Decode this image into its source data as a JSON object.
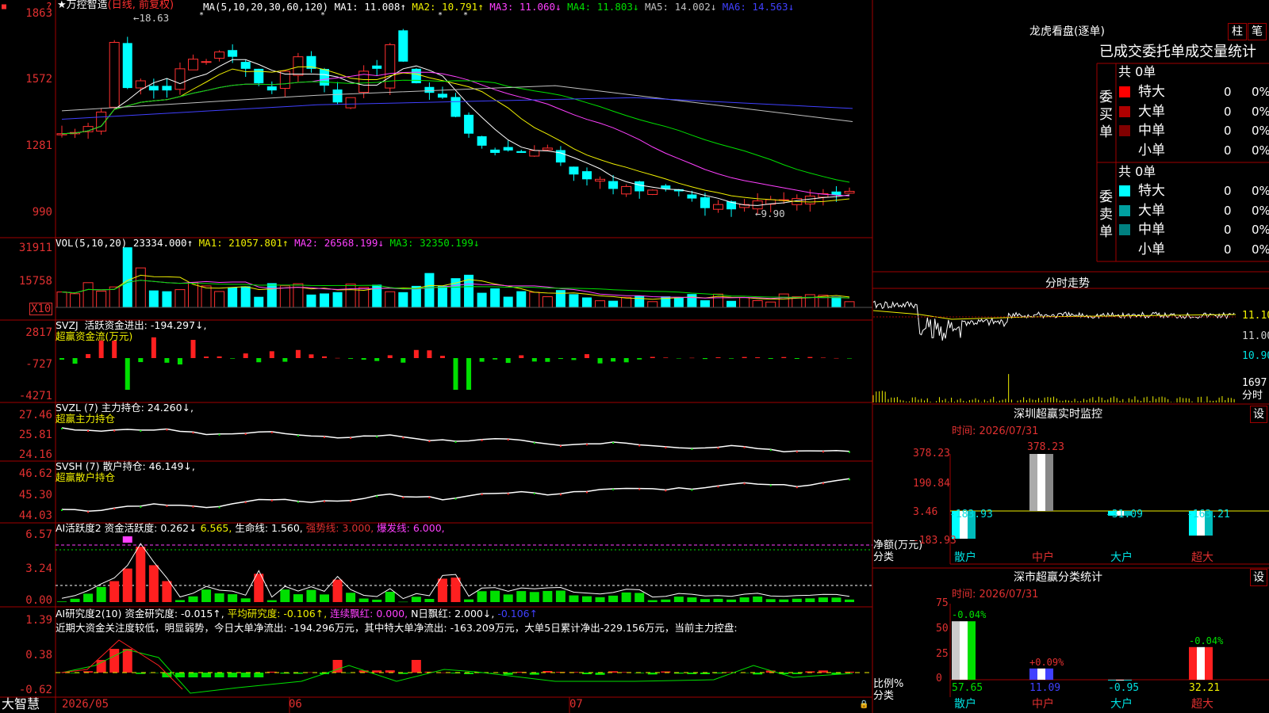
{
  "app": {
    "brand": "大智慧"
  },
  "stock": {
    "name": "万控智造",
    "period_label": "(日线, 前复权)",
    "star": "★",
    "high_mark": "←18.63",
    "low_mark": "←9.90"
  },
  "price_panel": {
    "ticks": [
      "1863",
      "1572",
      "1281",
      "990"
    ],
    "ma_items": [
      {
        "label": "MA(5,10,20,30,60,120)",
        "color": "#ffffff"
      },
      {
        "label": "MA1: 11.008↑",
        "color": "#ffffff"
      },
      {
        "label": "MA2: 10.791↑",
        "color": "#f0f000"
      },
      {
        "label": "MA3: 11.060↓",
        "color": "#ff40ff"
      },
      {
        "label": "MA4: 11.803↓",
        "color": "#00e000"
      },
      {
        "label": "MA5: 14.002↓",
        "color": "#c0c0c0"
      },
      {
        "label": "MA6: 14.563↓",
        "color": "#4040ff"
      }
    ]
  },
  "vol_panel": {
    "ticks": [
      "31911",
      "15758"
    ],
    "x10": "X10",
    "items": [
      {
        "label": "VOL(5,10,20)",
        "color": "#ffffff"
      },
      {
        "label": "23334.000↑",
        "color": "#ffffff"
      },
      {
        "label": "MA1: 21057.801↑",
        "color": "#f0f000"
      },
      {
        "label": "MA2: 26568.199↓",
        "color": "#ff40ff"
      },
      {
        "label": "MA3: 32350.199↓",
        "color": "#00e000"
      }
    ]
  },
  "svzj_panel": {
    "ticks": [
      "2817",
      "-727",
      "-4271"
    ],
    "title": "SVZJ  活跃资金进出: -194.297↓,",
    "subtitle": "超赢资金流(万元)"
  },
  "svzl_panel": {
    "ticks": [
      "27.46",
      "25.81",
      "24.16"
    ],
    "title": "SVZL (7) 主力持仓: 24.260↓,",
    "subtitle": "超赢主力持仓"
  },
  "svsh_panel": {
    "ticks": [
      "46.62",
      "45.30",
      "44.03"
    ],
    "title": "SVSH (7) 散户持仓: 46.149↓,",
    "subtitle": "超赢散户持仓"
  },
  "ai_panel": {
    "ticks": [
      "6.57",
      "3.24",
      "0.00"
    ],
    "items": [
      {
        "label": "AI活跃度2 资金活跃度: 0.262↓",
        "color": "#ffffff"
      },
      {
        "label": "6.565,",
        "color": "#f0f000"
      },
      {
        "label": "生命线: 1.560,",
        "color": "#ffffff"
      },
      {
        "label": "强势线: 3.000,",
        "color": "#e03030"
      },
      {
        "label": "爆发线: 6.000,",
        "color": "#ff40ff"
      }
    ]
  },
  "research_panel": {
    "ticks": [
      "1.39",
      "0.38",
      "-0.62"
    ],
    "items": [
      {
        "label": "AI研究度2(10) 资金研究度: -0.015↑,",
        "color": "#ffffff"
      },
      {
        "label": "平均研究度: -0.106↑,",
        "color": "#f0f000"
      },
      {
        "label": "连续飘红: 0.000,",
        "color": "#ff40ff"
      },
      {
        "label": "N日飘红: 2.000↓,",
        "color": "#ffffff"
      },
      {
        "label": "-0.106↑",
        "color": "#4040ff"
      }
    ],
    "note": "近期大资金关注度较低，明显弱势，今日大单净流出: -194.296万元，其中特大单净流出: -163.209万元，大单5日累计净出-229.156万元，当前主力控盘:"
  },
  "time_axis": {
    "labels": [
      "2026/05",
      "06",
      "07"
    ]
  },
  "longhu": {
    "title": "龙虎看盘(逐单)",
    "btn_col": "柱",
    "btn_pen": "笔",
    "header": "已成交委托单成交量统计",
    "buy_label": "委买单",
    "sell_label": "委卖单",
    "buy_total": "共 0单",
    "sell_total": "共 0单",
    "buy_rows": [
      {
        "name": "特大",
        "color": "#ff0000",
        "qty": "0",
        "pct": "0%"
      },
      {
        "name": "大单",
        "color": "#b00000",
        "qty": "0",
        "pct": "0%"
      },
      {
        "name": "中单",
        "color": "#800000",
        "qty": "0",
        "pct": "0%"
      },
      {
        "name": "小单",
        "color": "#000000",
        "qty": "0",
        "pct": "0%"
      }
    ],
    "sell_rows": [
      {
        "name": "特大",
        "color": "#00ffff",
        "qty": "0",
        "pct": "0%"
      },
      {
        "name": "大单",
        "color": "#00a0a0",
        "qty": "0",
        "pct": "0%"
      },
      {
        "name": "中单",
        "color": "#008080",
        "qty": "0",
        "pct": "0%"
      },
      {
        "name": "小单",
        "color": "#000000",
        "qty": "0",
        "pct": "0%"
      }
    ]
  },
  "intraday": {
    "title": "分时走势",
    "ticks": [
      "11.10",
      "11.00",
      "10.90"
    ],
    "vol_label": "1697",
    "unit": "分时"
  },
  "monitor": {
    "title": "深圳超赢实时监控",
    "set": "设",
    "time": "时间: 2026/07/31",
    "ticks": [
      "378.23",
      "190.84",
      "3.46",
      "-183.93"
    ],
    "ylabel": "净额(万元)",
    "xlabel": "分类",
    "cats": [
      "散户",
      "中户",
      "大户",
      "超大"
    ],
    "values": [
      -183.93,
      378.23,
      -31.09,
      -163.21
    ],
    "labels": [
      "-183.93",
      "378.23",
      "-31.09",
      "-163.21"
    ]
  },
  "classify": {
    "title": "深市超赢分类统计",
    "set": "设",
    "time": "时间: 2026/07/31",
    "ticks": [
      "75",
      "50",
      "25",
      "0"
    ],
    "ylabel": "比例%",
    "xlabel": "分类",
    "cats": [
      "散户",
      "中户",
      "大户",
      "超大"
    ],
    "values": [
      57.65,
      11.09,
      -0.95,
      32.21
    ],
    "bottom_labels": [
      "57.65",
      "11.09",
      "-0.95",
      "32.21"
    ],
    "top_labels": [
      "-0.04%",
      "+0.09%",
      "",
      "-0.04%"
    ]
  }
}
